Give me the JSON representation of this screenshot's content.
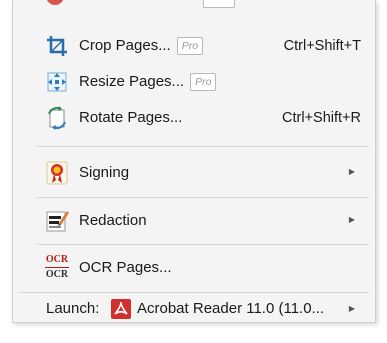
{
  "menu": {
    "pro_badge": "Pro",
    "items": [
      {
        "label": "Crop Pages...",
        "shortcut": "Ctrl+Shift+T"
      },
      {
        "label": "Resize Pages..."
      },
      {
        "label": "Rotate Pages...",
        "shortcut": "Ctrl+Shift+R"
      },
      {
        "label": "Signing",
        "submenu": true
      },
      {
        "label": "Redaction",
        "submenu": true
      },
      {
        "label": "OCR Pages...",
        "icon_text_top": "OCR",
        "icon_text_bottom": "OCR"
      },
      {
        "label": "Launch:",
        "app": "Acrobat Reader 11.0 (11.0...",
        "submenu": true
      }
    ]
  },
  "colors": {
    "menu_bg": "#f4f4f4",
    "separator": "#d6d6d6",
    "accent_red": "#c62828",
    "crop_blue": "#2b6cb0"
  }
}
